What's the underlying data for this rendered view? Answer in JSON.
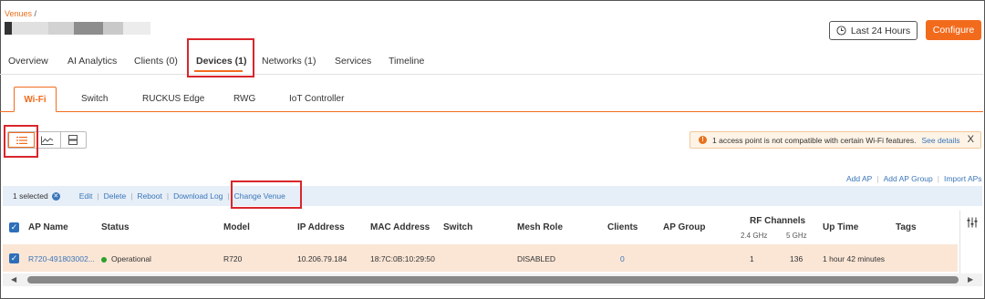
{
  "breadcrumb": {
    "root": "Venues",
    "separator": "/"
  },
  "header": {
    "time_range_label": "Last 24 Hours",
    "configure_label": "Configure"
  },
  "tabs": [
    {
      "label": "Overview"
    },
    {
      "label": "AI Analytics"
    },
    {
      "label": "Clients (0)"
    },
    {
      "label": "Devices (1)",
      "active": true
    },
    {
      "label": "Networks (1)"
    },
    {
      "label": "Services"
    },
    {
      "label": "Timeline"
    }
  ],
  "subtabs": [
    {
      "label": "Wi-Fi",
      "active": true
    },
    {
      "label": "Switch"
    },
    {
      "label": "RUCKUS Edge"
    },
    {
      "label": "RWG"
    },
    {
      "label": "IoT Controller"
    }
  ],
  "view_modes": [
    {
      "icon": "list-view-icon",
      "active": true
    },
    {
      "icon": "chart-view-icon"
    },
    {
      "icon": "server-view-icon"
    }
  ],
  "alert": {
    "text": "1 access point is not compatible with certain Wi-Fi features.",
    "link": "See details",
    "close": "X"
  },
  "top_actions": [
    "Add AP",
    "Add AP Group",
    "Import APs"
  ],
  "selection": {
    "count_label": "1 selected",
    "actions": [
      "Edit",
      "Delete",
      "Reboot",
      "Download Log",
      "Change Venue"
    ]
  },
  "table": {
    "columns": {
      "ap_name": "AP Name",
      "status": "Status",
      "model": "Model",
      "ip": "IP Address",
      "mac": "MAC Address",
      "switch": "Switch",
      "mesh_role": "Mesh Role",
      "clients": "Clients",
      "ap_group": "AP Group",
      "rf_channels": "RF Channels",
      "rf_24": "2.4 GHz",
      "rf_5": "5 GHz",
      "uptime": "Up Time",
      "tags": "Tags"
    },
    "rows": [
      {
        "ap_name": "R720-491803002...",
        "status": "Operational",
        "model": "R720",
        "ip": "10.206.79.184",
        "mac": "18:7C:0B:10:29:50",
        "mesh_role": "DISABLED",
        "clients": "0",
        "rf_24": "1",
        "rf_5": "136",
        "uptime": "1 hour 42 minutes"
      }
    ]
  },
  "colors": {
    "accent": "#f26b1d",
    "link": "#3a76b8",
    "highlight": "#d9262c",
    "selected_row": "#fbe6d6"
  }
}
